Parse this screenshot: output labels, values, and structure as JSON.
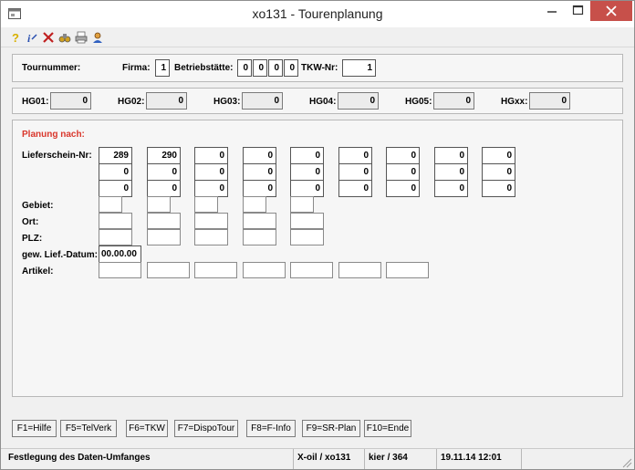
{
  "window": {
    "title": "xo131 - Tourenplanung"
  },
  "toolbar_icons": [
    "help-icon",
    "info-icon",
    "delete-icon",
    "binoculars-icon",
    "print-icon",
    "user-icon"
  ],
  "header": {
    "tournummer_label": "Tournummer:",
    "firma_label": "Firma:",
    "firma": "1",
    "betriebsstaette_label": "Betriebstätte:",
    "betriebsstaette": [
      "0",
      "0",
      "0",
      "0"
    ],
    "tkw_label": "TKW-Nr:",
    "tkw": "1"
  },
  "hg": [
    {
      "label": "HG01:",
      "value": "0"
    },
    {
      "label": "HG02:",
      "value": "0"
    },
    {
      "label": "HG03:",
      "value": "0"
    },
    {
      "label": "HG04:",
      "value": "0"
    },
    {
      "label": "HG05:",
      "value": "0"
    },
    {
      "label": "HGxx:",
      "value": "0"
    }
  ],
  "planung": {
    "heading": "Planung nach:",
    "labels": {
      "lieferschein": "Lieferschein-Nr:",
      "gebiet": "Gebiet:",
      "ort": "Ort:",
      "plz": "PLZ:",
      "datum": "gew. Lief.-Datum:",
      "artikel": "Artikel:"
    },
    "lieferschein": [
      [
        "289",
        "0",
        "0"
      ],
      [
        "290",
        "0",
        "0"
      ],
      [
        "0",
        "0",
        "0"
      ],
      [
        "0",
        "0",
        "0"
      ],
      [
        "0",
        "0",
        "0"
      ],
      [
        "0",
        "0",
        "0"
      ],
      [
        "0",
        "0",
        "0"
      ],
      [
        "0",
        "0",
        "0"
      ],
      [
        "0",
        "0",
        "0"
      ]
    ],
    "gebiet": [
      "",
      "",
      "",
      "",
      ""
    ],
    "ort": [
      "",
      "",
      "",
      "",
      ""
    ],
    "plz": [
      "",
      "",
      "",
      "",
      ""
    ],
    "datum": "00.00.00",
    "artikel": [
      "",
      "",
      "",
      "",
      "",
      "",
      ""
    ]
  },
  "function_keys": [
    "F1=Hilfe",
    "F5=TelVerk",
    "F6=TKW",
    "F7=DispoTour",
    "F8=F-Info",
    "F9=SR-Plan",
    "F10=Ende"
  ],
  "statusbar": {
    "message": "Festlegung des Daten-Umfanges",
    "system": "X-oil / xo131",
    "user": "kier / 364",
    "datetime": "19.11.14 12:01"
  }
}
